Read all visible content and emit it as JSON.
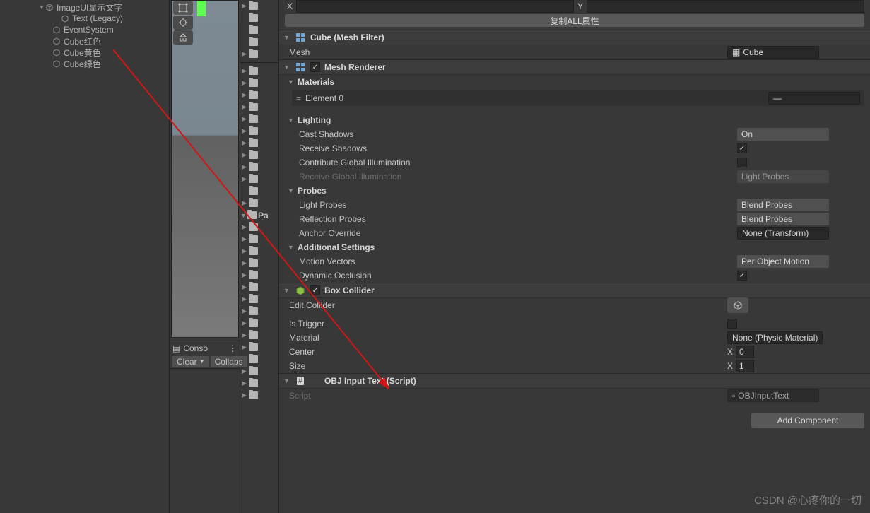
{
  "hierarchy": {
    "items": [
      {
        "label": "ImageUI显示文字",
        "indent": 50,
        "arrow": "▼"
      },
      {
        "label": "Text (Legacy)",
        "indent": 72,
        "arrow": ""
      },
      {
        "label": "EventSystem",
        "indent": 60,
        "arrow": ""
      },
      {
        "label": "Cube红色",
        "indent": 60,
        "arrow": ""
      },
      {
        "label": "Cube黄色",
        "indent": 60,
        "arrow": ""
      },
      {
        "label": "Cube绿色",
        "indent": 60,
        "arrow": ""
      }
    ]
  },
  "console": {
    "tab": "Conso",
    "clear": "Clear",
    "collapse": "Collaps"
  },
  "project": {
    "packages": "Pa"
  },
  "inspector": {
    "copy_all": "复制ALL属性",
    "x_label": "X",
    "mesh_filter": {
      "title": "Cube (Mesh Filter)",
      "mesh_label": "Mesh",
      "mesh_value": "Cube"
    },
    "mesh_renderer": {
      "title": "Mesh Renderer",
      "materials": "Materials",
      "element0": "Element 0",
      "lighting": "Lighting",
      "cast_shadows": "Cast Shadows",
      "cast_shadows_val": "On",
      "receive_shadows": "Receive Shadows",
      "contribute_gi": "Contribute Global Illumination",
      "receive_gi": "Receive Global Illumination",
      "receive_gi_val": "Light Probes",
      "probes": "Probes",
      "light_probes": "Light Probes",
      "light_probes_val": "Blend Probes",
      "reflection_probes": "Reflection Probes",
      "reflection_probes_val": "Blend Probes",
      "anchor_override": "Anchor Override",
      "anchor_override_val": "None (Transform)",
      "additional": "Additional Settings",
      "motion_vectors": "Motion Vectors",
      "motion_vectors_val": "Per Object Motion",
      "dynamic_occlusion": "Dynamic Occlusion"
    },
    "box_collider": {
      "title": "Box Collider",
      "edit": "Edit Collider",
      "is_trigger": "Is Trigger",
      "material": "Material",
      "material_val": "None (Physic Material)",
      "center": "Center",
      "center_x": "0",
      "size": "Size",
      "size_x": "1"
    },
    "script_comp": {
      "title": "OBJ Input Text (Script)",
      "script_label": "Script",
      "script_val": "OBJInputText"
    },
    "add_component": "Add Component"
  },
  "watermark": "CSDN @心疼你的一切"
}
